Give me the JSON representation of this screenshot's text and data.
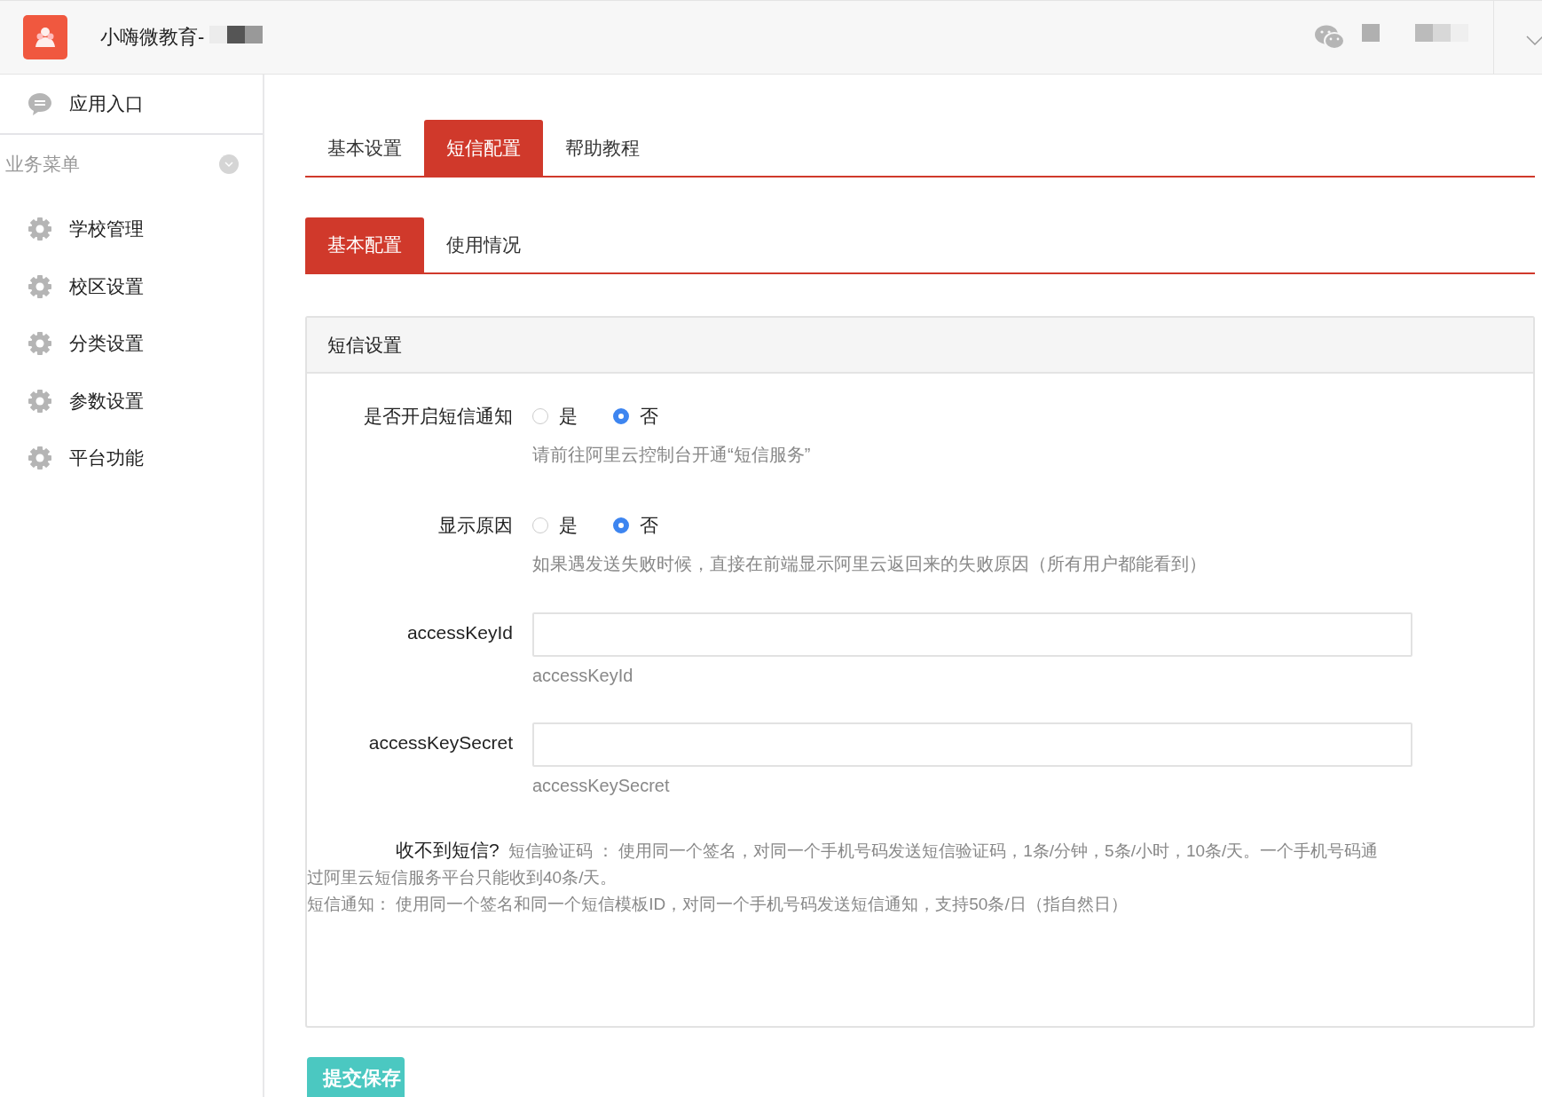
{
  "app_header": {
    "title": "小嗨微教育-"
  },
  "sidebar": {
    "entry": {
      "label": "应用入口"
    },
    "section_title": "业务菜单",
    "items": [
      {
        "label": "学校管理"
      },
      {
        "label": "校区设置"
      },
      {
        "label": "分类设置"
      },
      {
        "label": "参数设置"
      },
      {
        "label": "平台功能"
      }
    ]
  },
  "tabs": [
    {
      "label": "基本设置",
      "selected": false
    },
    {
      "label": "短信配置",
      "selected": true
    },
    {
      "label": "帮助教程",
      "selected": false
    }
  ],
  "subtabs": [
    {
      "label": "基本配置",
      "selected": true
    },
    {
      "label": "使用情况",
      "selected": false
    }
  ],
  "panel": {
    "title": "短信设置",
    "fields": [
      {
        "kind": "radio",
        "label": "是否开启短信通知",
        "options": [
          {
            "label": "是",
            "selected": false
          },
          {
            "label": "否",
            "selected": true
          }
        ],
        "help": "请前往阿里云控制台开通“短信服务”"
      },
      {
        "kind": "radio",
        "label": "显示原因",
        "options": [
          {
            "label": "是",
            "selected": false
          },
          {
            "label": "否",
            "selected": true
          }
        ],
        "help": "如果遇发送失败时候，直接在前端显示阿里云返回来的失败原因（所有用户都能看到）"
      },
      {
        "kind": "text",
        "label": "accessKeyId",
        "help": "accessKeyId"
      },
      {
        "kind": "text",
        "label": "accessKeySecret",
        "help": "accessKeySecret"
      }
    ],
    "notice": {
      "title": "收不到短信?",
      "lines": [
        "短信验证码 ： 使用同一个签名，对同一个手机号码发送短信验证码，1条/分钟，5条/小时，10条/天。一个手机号码通",
        "过阿里云短信服务平台只能收到40条/天。",
        "短信通知： 使用同一个签名和同一个短信模板ID，对同一个手机号码发送短信通知，支持50条/日（指自然日）"
      ]
    }
  },
  "submit_button": "提交保存"
}
